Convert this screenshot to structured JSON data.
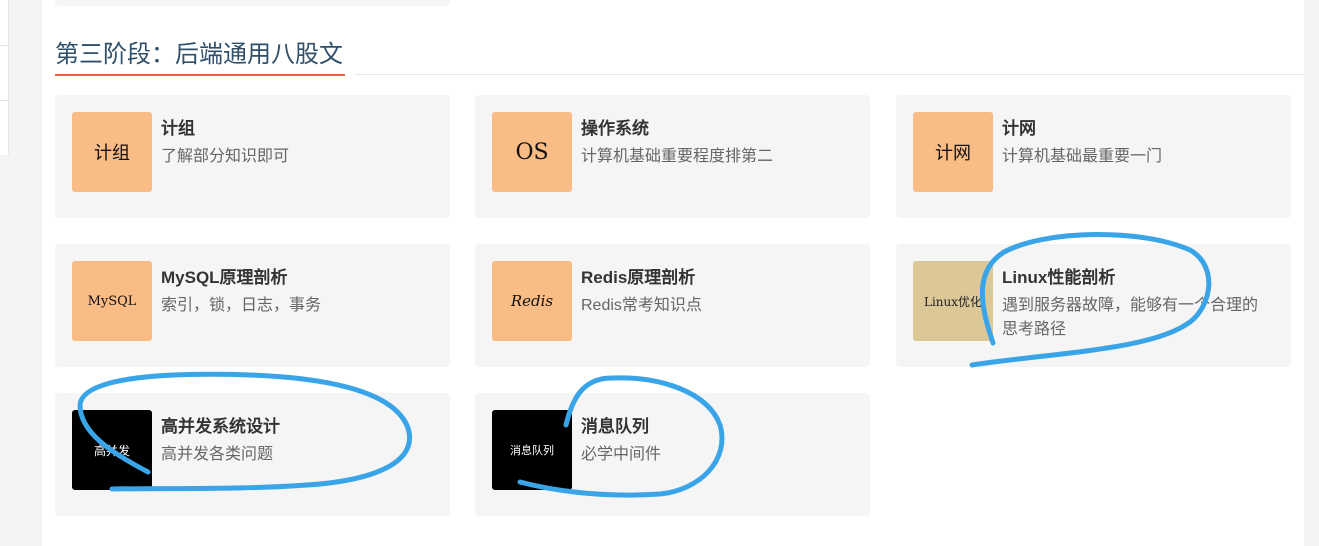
{
  "section": {
    "title": "第三阶段：后端通用八股文"
  },
  "colors": {
    "accent_underline": "#e0663f",
    "annotation_stroke": "#3aa4e8",
    "thumb_orange": "#f9bc85",
    "thumb_tan": "#dcc896",
    "thumb_black": "#000000"
  },
  "courses": [
    {
      "title": "计组",
      "desc": "了解部分知识即可",
      "thumb_text": "计组",
      "thumb_icon": "thumbnail-jizu"
    },
    {
      "title": "操作系统",
      "desc": "计算机基础重要程度排第二",
      "thumb_text": "OS",
      "thumb_icon": "thumbnail-os"
    },
    {
      "title": "计网",
      "desc": "计算机基础最重要一门",
      "thumb_text": "计网",
      "thumb_icon": "thumbnail-jiwang"
    },
    {
      "title": "MySQL原理剖析",
      "desc": "索引，锁，日志，事务",
      "thumb_text": "MySQL",
      "thumb_icon": "thumbnail-mysql"
    },
    {
      "title": "Redis原理剖析",
      "desc": "Redis常考知识点",
      "thumb_text": "Redis",
      "thumb_icon": "thumbnail-redis"
    },
    {
      "title": "Linux性能剖析",
      "desc": "遇到服务器故障，能够有一个合理的思考路径",
      "thumb_text": "Linux优化",
      "thumb_icon": "thumbnail-linux"
    },
    {
      "title": "高并发系统设计",
      "desc": "高并发各类问题",
      "thumb_text": "高并发",
      "thumb_icon": "thumbnail-gaobingfa"
    },
    {
      "title": "消息队列",
      "desc": "必学中间件",
      "thumb_text": "消息队列",
      "thumb_icon": "thumbnail-mq"
    }
  ]
}
